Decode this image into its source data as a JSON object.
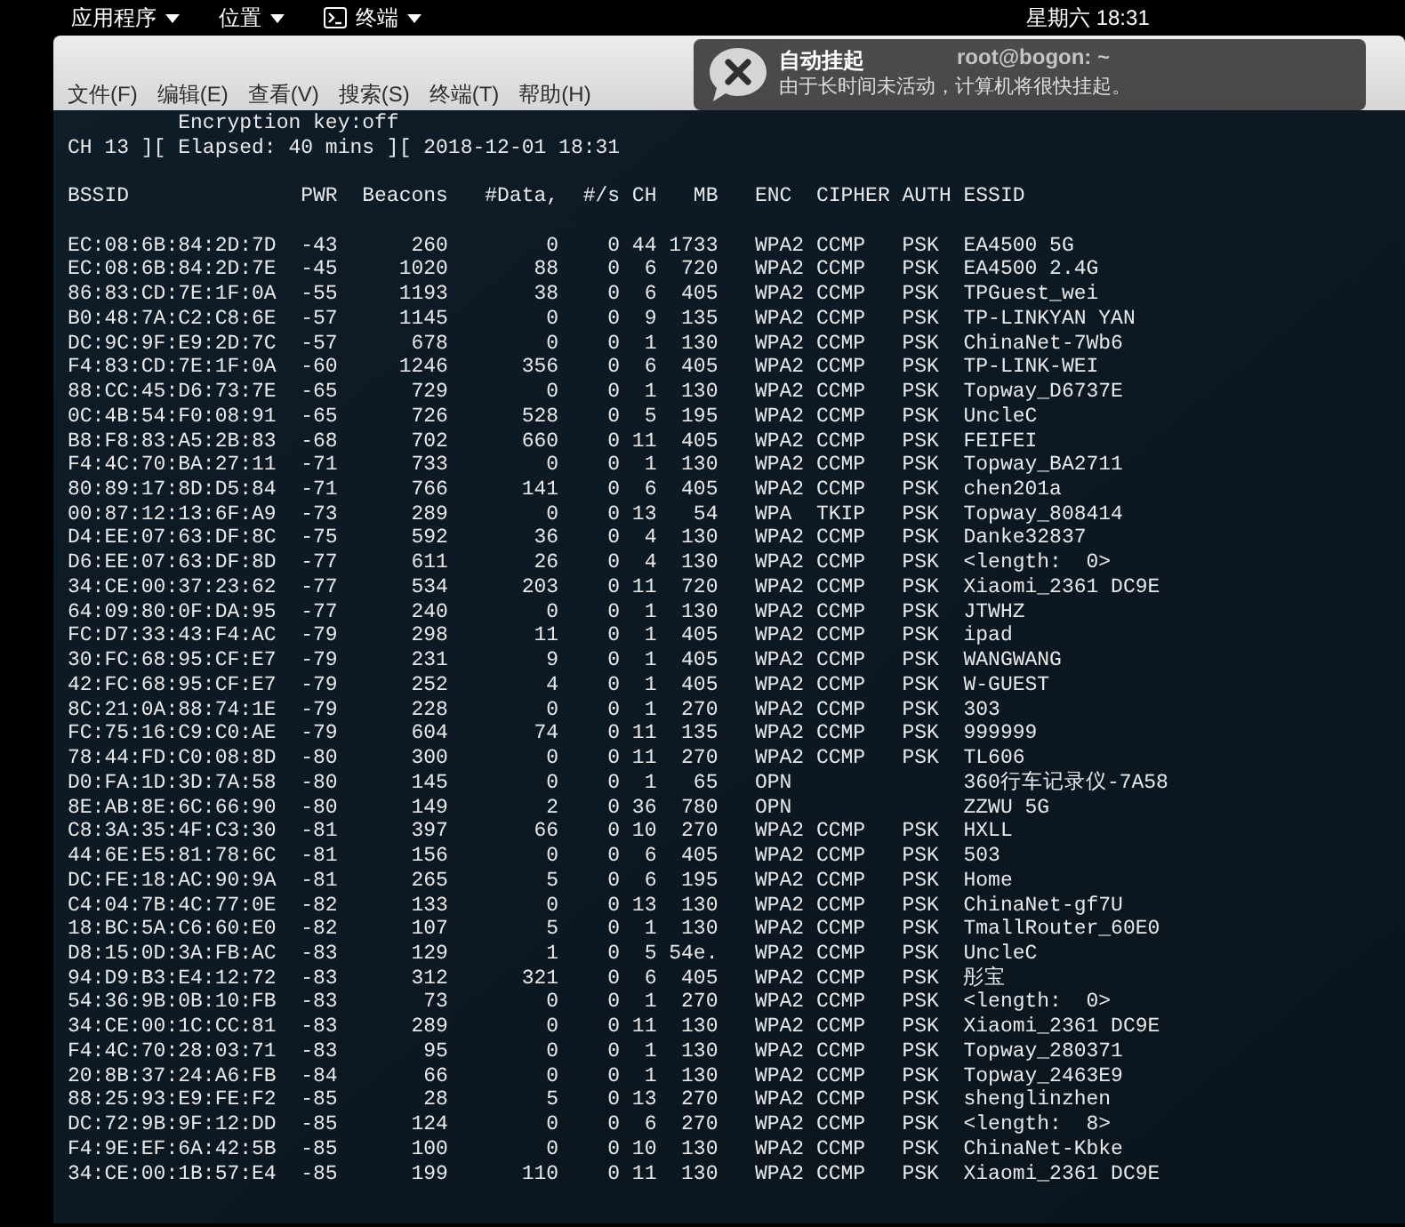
{
  "top_bar": {
    "menus": [
      {
        "label": "应用程序"
      },
      {
        "label": "位置"
      },
      {
        "label": "终端",
        "kind": "terminal"
      }
    ],
    "clock": "星期六 18:31"
  },
  "window": {
    "title": "root@bogon: ~",
    "menu": [
      "文件(F)",
      "编辑(E)",
      "查看(V)",
      "搜索(S)",
      "终端(T)",
      "帮助(H)"
    ]
  },
  "notification": {
    "title": "自动挂起",
    "body": "由于长时间未活动，计算机将很快挂起。"
  },
  "terminal": {
    "lines": [
      "Encryption key:off",
      "CH 13 ][ Elapsed: 40 mins ][ 2018-12-01 18:31"
    ],
    "table": {
      "columns": [
        "BSSID",
        "PWR",
        "Beacons",
        "#Data,",
        "#/s",
        "CH",
        "MB",
        "ENC",
        "CIPHER",
        "AUTH",
        "ESSID"
      ],
      "rows": [
        {
          "bssid": "EC:08:6B:84:2D:7D",
          "pwr": "-43",
          "beacons": "260",
          "data": "0",
          "per_s": "0",
          "ch": "44",
          "mb": "1733",
          "enc": "WPA2",
          "cipher": "CCMP",
          "auth": "PSK",
          "essid": "EA4500 5G"
        },
        {
          "bssid": "EC:08:6B:84:2D:7E",
          "pwr": "-45",
          "beacons": "1020",
          "data": "88",
          "per_s": "0",
          "ch": "6",
          "mb": "720",
          "enc": "WPA2",
          "cipher": "CCMP",
          "auth": "PSK",
          "essid": "EA4500 2.4G"
        },
        {
          "bssid": "86:83:CD:7E:1F:0A",
          "pwr": "-55",
          "beacons": "1193",
          "data": "38",
          "per_s": "0",
          "ch": "6",
          "mb": "405",
          "enc": "WPA2",
          "cipher": "CCMP",
          "auth": "PSK",
          "essid": "TPGuest_wei"
        },
        {
          "bssid": "B0:48:7A:C2:C8:6E",
          "pwr": "-57",
          "beacons": "1145",
          "data": "0",
          "per_s": "0",
          "ch": "9",
          "mb": "135",
          "enc": "WPA2",
          "cipher": "CCMP",
          "auth": "PSK",
          "essid": "TP-LINKYAN YAN"
        },
        {
          "bssid": "DC:9C:9F:E9:2D:7C",
          "pwr": "-57",
          "beacons": "678",
          "data": "0",
          "per_s": "0",
          "ch": "1",
          "mb": "130",
          "enc": "WPA2",
          "cipher": "CCMP",
          "auth": "PSK",
          "essid": "ChinaNet-7Wb6"
        },
        {
          "bssid": "F4:83:CD:7E:1F:0A",
          "pwr": "-60",
          "beacons": "1246",
          "data": "356",
          "per_s": "0",
          "ch": "6",
          "mb": "405",
          "enc": "WPA2",
          "cipher": "CCMP",
          "auth": "PSK",
          "essid": "TP-LINK-WEI"
        },
        {
          "bssid": "88:CC:45:D6:73:7E",
          "pwr": "-65",
          "beacons": "729",
          "data": "0",
          "per_s": "0",
          "ch": "1",
          "mb": "130",
          "enc": "WPA2",
          "cipher": "CCMP",
          "auth": "PSK",
          "essid": "Topway_D6737E"
        },
        {
          "bssid": "0C:4B:54:F0:08:91",
          "pwr": "-65",
          "beacons": "726",
          "data": "528",
          "per_s": "0",
          "ch": "5",
          "mb": "195",
          "enc": "WPA2",
          "cipher": "CCMP",
          "auth": "PSK",
          "essid": "UncleC"
        },
        {
          "bssid": "B8:F8:83:A5:2B:83",
          "pwr": "-68",
          "beacons": "702",
          "data": "660",
          "per_s": "0",
          "ch": "11",
          "mb": "405",
          "enc": "WPA2",
          "cipher": "CCMP",
          "auth": "PSK",
          "essid": "FEIFEI"
        },
        {
          "bssid": "F4:4C:70:BA:27:11",
          "pwr": "-71",
          "beacons": "733",
          "data": "0",
          "per_s": "0",
          "ch": "1",
          "mb": "130",
          "enc": "WPA2",
          "cipher": "CCMP",
          "auth": "PSK",
          "essid": "Topway_BA2711"
        },
        {
          "bssid": "80:89:17:8D:D5:84",
          "pwr": "-71",
          "beacons": "766",
          "data": "141",
          "per_s": "0",
          "ch": "6",
          "mb": "405",
          "enc": "WPA2",
          "cipher": "CCMP",
          "auth": "PSK",
          "essid": "chen201a"
        },
        {
          "bssid": "00:87:12:13:6F:A9",
          "pwr": "-73",
          "beacons": "289",
          "data": "0",
          "per_s": "0",
          "ch": "13",
          "mb": "54",
          "enc": "WPA",
          "cipher": "TKIP",
          "auth": "PSK",
          "essid": "Topway_808414"
        },
        {
          "bssid": "D4:EE:07:63:DF:8C",
          "pwr": "-75",
          "beacons": "592",
          "data": "36",
          "per_s": "0",
          "ch": "4",
          "mb": "130",
          "enc": "WPA2",
          "cipher": "CCMP",
          "auth": "PSK",
          "essid": "Danke32837"
        },
        {
          "bssid": "D6:EE:07:63:DF:8D",
          "pwr": "-77",
          "beacons": "611",
          "data": "26",
          "per_s": "0",
          "ch": "4",
          "mb": "130",
          "enc": "WPA2",
          "cipher": "CCMP",
          "auth": "PSK",
          "essid": "<length:  0>"
        },
        {
          "bssid": "34:CE:00:37:23:62",
          "pwr": "-77",
          "beacons": "534",
          "data": "203",
          "per_s": "0",
          "ch": "11",
          "mb": "720",
          "enc": "WPA2",
          "cipher": "CCMP",
          "auth": "PSK",
          "essid": "Xiaomi_2361 DC9E"
        },
        {
          "bssid": "64:09:80:0F:DA:95",
          "pwr": "-77",
          "beacons": "240",
          "data": "0",
          "per_s": "0",
          "ch": "1",
          "mb": "130",
          "enc": "WPA2",
          "cipher": "CCMP",
          "auth": "PSK",
          "essid": "JTWHZ"
        },
        {
          "bssid": "FC:D7:33:43:F4:AC",
          "pwr": "-79",
          "beacons": "298",
          "data": "11",
          "per_s": "0",
          "ch": "1",
          "mb": "405",
          "enc": "WPA2",
          "cipher": "CCMP",
          "auth": "PSK",
          "essid": "ipad"
        },
        {
          "bssid": "30:FC:68:95:CF:E7",
          "pwr": "-79",
          "beacons": "231",
          "data": "9",
          "per_s": "0",
          "ch": "1",
          "mb": "405",
          "enc": "WPA2",
          "cipher": "CCMP",
          "auth": "PSK",
          "essid": "WANGWANG"
        },
        {
          "bssid": "42:FC:68:95:CF:E7",
          "pwr": "-79",
          "beacons": "252",
          "data": "4",
          "per_s": "0",
          "ch": "1",
          "mb": "405",
          "enc": "WPA2",
          "cipher": "CCMP",
          "auth": "PSK",
          "essid": "W-GUEST"
        },
        {
          "bssid": "8C:21:0A:88:74:1E",
          "pwr": "-79",
          "beacons": "228",
          "data": "0",
          "per_s": "0",
          "ch": "1",
          "mb": "270",
          "enc": "WPA2",
          "cipher": "CCMP",
          "auth": "PSK",
          "essid": "303"
        },
        {
          "bssid": "FC:75:16:C9:C0:AE",
          "pwr": "-79",
          "beacons": "604",
          "data": "74",
          "per_s": "0",
          "ch": "11",
          "mb": "135",
          "enc": "WPA2",
          "cipher": "CCMP",
          "auth": "PSK",
          "essid": "999999"
        },
        {
          "bssid": "78:44:FD:C0:08:8D",
          "pwr": "-80",
          "beacons": "300",
          "data": "0",
          "per_s": "0",
          "ch": "11",
          "mb": "270",
          "enc": "WPA2",
          "cipher": "CCMP",
          "auth": "PSK",
          "essid": "TL606"
        },
        {
          "bssid": "D0:FA:1D:3D:7A:58",
          "pwr": "-80",
          "beacons": "145",
          "data": "0",
          "per_s": "0",
          "ch": "1",
          "mb": "65",
          "enc": "OPN",
          "essid": "360行车记录仪-7A58"
        },
        {
          "bssid": "8E:AB:8E:6C:66:90",
          "pwr": "-80",
          "beacons": "149",
          "data": "2",
          "per_s": "0",
          "ch": "36",
          "mb": "780",
          "enc": "OPN",
          "essid": "ZZWU 5G"
        },
        {
          "bssid": "C8:3A:35:4F:C3:30",
          "pwr": "-81",
          "beacons": "397",
          "data": "66",
          "per_s": "0",
          "ch": "10",
          "mb": "270",
          "enc": "WPA2",
          "cipher": "CCMP",
          "auth": "PSK",
          "essid": "HXLL"
        },
        {
          "bssid": "44:6E:E5:81:78:6C",
          "pwr": "-81",
          "beacons": "156",
          "data": "0",
          "per_s": "0",
          "ch": "6",
          "mb": "405",
          "enc": "WPA2",
          "cipher": "CCMP",
          "auth": "PSK",
          "essid": "503"
        },
        {
          "bssid": "DC:FE:18:AC:90:9A",
          "pwr": "-81",
          "beacons": "265",
          "data": "5",
          "per_s": "0",
          "ch": "6",
          "mb": "195",
          "enc": "WPA2",
          "cipher": "CCMP",
          "auth": "PSK",
          "essid": "Home"
        },
        {
          "bssid": "C4:04:7B:4C:77:0E",
          "pwr": "-82",
          "beacons": "133",
          "data": "0",
          "per_s": "0",
          "ch": "13",
          "mb": "130",
          "enc": "WPA2",
          "cipher": "CCMP",
          "auth": "PSK",
          "essid": "ChinaNet-gf7U"
        },
        {
          "bssid": "18:BC:5A:C6:60:E0",
          "pwr": "-82",
          "beacons": "107",
          "data": "5",
          "per_s": "0",
          "ch": "1",
          "mb": "130",
          "enc": "WPA2",
          "cipher": "CCMP",
          "auth": "PSK",
          "essid": "TmallRouter_60E0"
        },
        {
          "bssid": "D8:15:0D:3A:FB:AC",
          "pwr": "-83",
          "beacons": "129",
          "data": "1",
          "per_s": "0",
          "ch": "5",
          "mb": "54e.",
          "enc": "WPA2",
          "cipher": "CCMP",
          "auth": "PSK",
          "essid": "UncleC"
        },
        {
          "bssid": "94:D9:B3:E4:12:72",
          "pwr": "-83",
          "beacons": "312",
          "data": "321",
          "per_s": "0",
          "ch": "6",
          "mb": "405",
          "enc": "WPA2",
          "cipher": "CCMP",
          "auth": "PSK",
          "essid": "彤宝"
        },
        {
          "bssid": "54:36:9B:0B:10:FB",
          "pwr": "-83",
          "beacons": "73",
          "data": "0",
          "per_s": "0",
          "ch": "1",
          "mb": "270",
          "enc": "WPA2",
          "cipher": "CCMP",
          "auth": "PSK",
          "essid": "<length:  0>"
        },
        {
          "bssid": "34:CE:00:1C:CC:81",
          "pwr": "-83",
          "beacons": "289",
          "data": "0",
          "per_s": "0",
          "ch": "11",
          "mb": "130",
          "enc": "WPA2",
          "cipher": "CCMP",
          "auth": "PSK",
          "essid": "Xiaomi_2361 DC9E"
        },
        {
          "bssid": "F4:4C:70:28:03:71",
          "pwr": "-83",
          "beacons": "95",
          "data": "0",
          "per_s": "0",
          "ch": "1",
          "mb": "130",
          "enc": "WPA2",
          "cipher": "CCMP",
          "auth": "PSK",
          "essid": "Topway_280371"
        },
        {
          "bssid": "20:8B:37:24:A6:FB",
          "pwr": "-84",
          "beacons": "66",
          "data": "0",
          "per_s": "0",
          "ch": "1",
          "mb": "130",
          "enc": "WPA2",
          "cipher": "CCMP",
          "auth": "PSK",
          "essid": "Topway_2463E9"
        },
        {
          "bssid": "88:25:93:E9:FE:F2",
          "pwr": "-85",
          "beacons": "28",
          "data": "5",
          "per_s": "0",
          "ch": "13",
          "mb": "270",
          "enc": "WPA2",
          "cipher": "CCMP",
          "auth": "PSK",
          "essid": "shenglinzhen"
        },
        {
          "bssid": "DC:72:9B:9F:12:DD",
          "pwr": "-85",
          "beacons": "124",
          "data": "0",
          "per_s": "0",
          "ch": "6",
          "mb": "270",
          "enc": "WPA2",
          "cipher": "CCMP",
          "auth": "PSK",
          "essid": "<length:  8>"
        },
        {
          "bssid": "F4:9E:EF:6A:42:5B",
          "pwr": "-85",
          "beacons": "100",
          "data": "0",
          "per_s": "0",
          "ch": "10",
          "mb": "130",
          "enc": "WPA2",
          "cipher": "CCMP",
          "auth": "PSK",
          "essid": "ChinaNet-Kbke"
        },
        {
          "bssid": "34:CE:00:1B:57:E4",
          "pwr": "-85",
          "beacons": "199",
          "data": "110",
          "per_s": "0",
          "ch": "11",
          "mb": "130",
          "enc": "WPA2",
          "cipher": "CCMP",
          "auth": "PSK",
          "essid": "Xiaomi_2361 DC9E"
        }
      ]
    }
  }
}
